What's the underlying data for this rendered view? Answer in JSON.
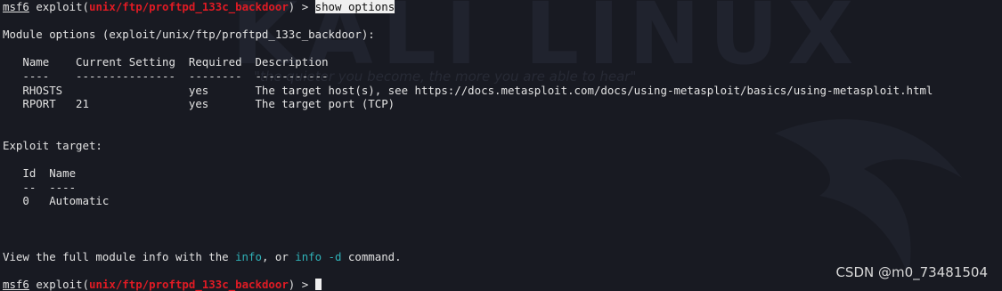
{
  "prompt": {
    "msf": "msf6",
    "exploit_word": "exploit",
    "open_paren": "(",
    "module": "unix/ftp/proftpd_133c_backdoor",
    "close_arrow": ") > ",
    "command": "show options"
  },
  "module_options_header": "Module options (exploit/unix/ftp/proftpd_133c_backdoor):",
  "options_table": {
    "header": "   Name    Current Setting  Required  Description",
    "separator": "   ----    ---------------  --------  -----------",
    "rows": [
      "   RHOSTS                   yes       The target host(s), see https://docs.metasploit.com/docs/using-metasploit/basics/using-metasploit.html",
      "   RPORT   21               yes       The target port (TCP)"
    ]
  },
  "exploit_target_header": "Exploit target:",
  "target_table": {
    "header": "   Id  Name",
    "separator": "   --  ----",
    "rows": [
      "   0   Automatic"
    ]
  },
  "info_line": {
    "prefix": "View the full module info with the ",
    "info": "info",
    "middle": ", or ",
    "info_d": "info -d",
    "suffix": " command."
  },
  "watermark": "CSDN @m0_73481504",
  "background": {
    "logo": "KALI LINUX",
    "quote": "\"the quieter you become, the more you are able to hear\""
  },
  "colors": {
    "background": "#181a22",
    "text": "#e2e2e2",
    "module_red": "#e01b24",
    "info_cyan": "#2fb2b8"
  }
}
